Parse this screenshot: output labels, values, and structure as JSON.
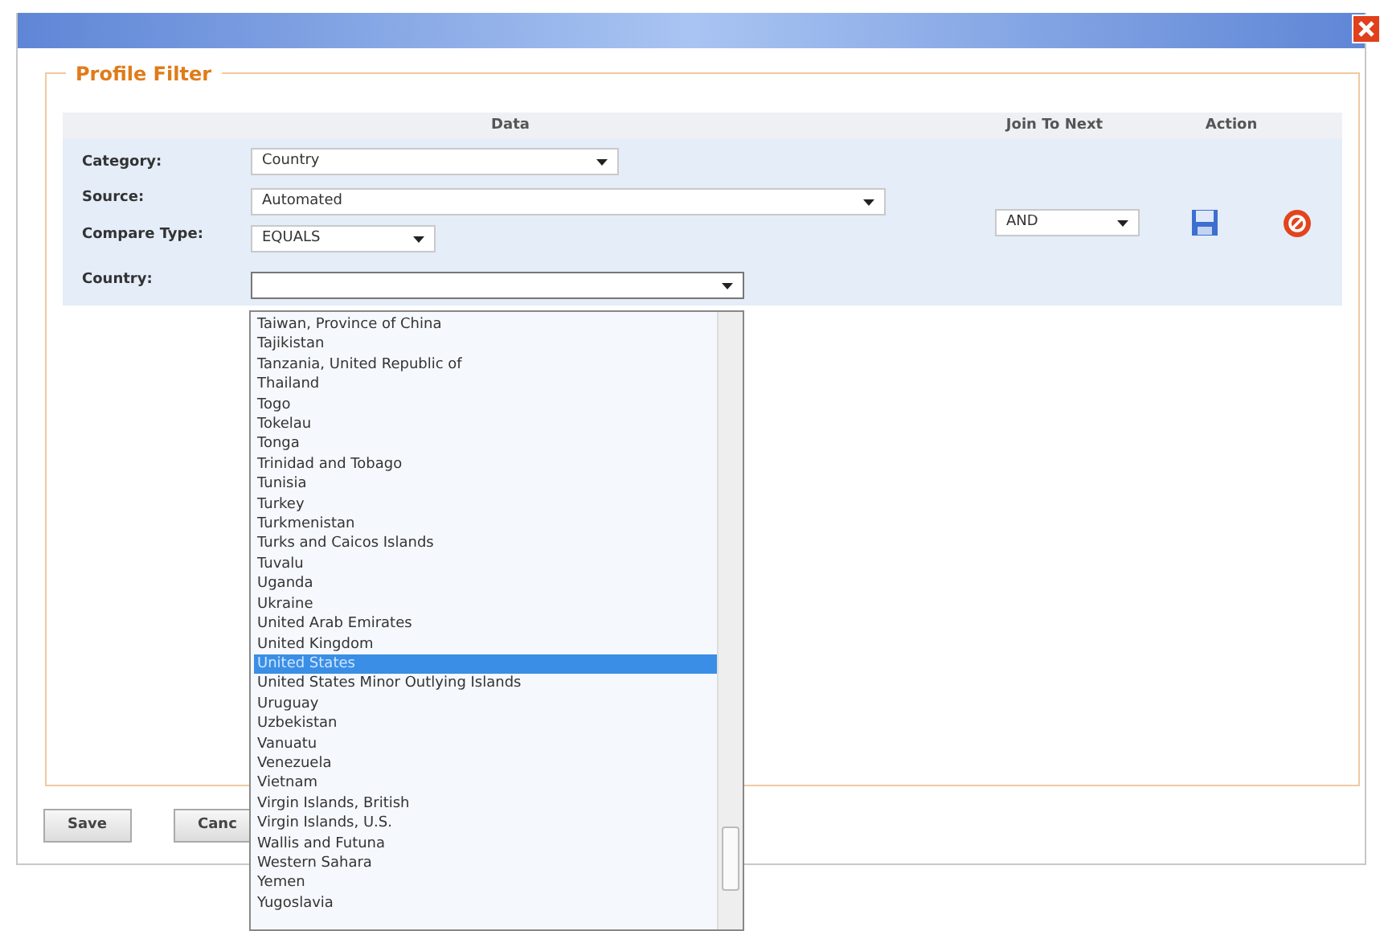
{
  "fieldset": {
    "legend": "Profile Filter"
  },
  "table": {
    "columns": [
      "Data",
      "Join To Next",
      "Action"
    ]
  },
  "fields": [
    {
      "label": "Category:",
      "value": "Country",
      "kind": "short"
    },
    {
      "label": "Source:",
      "value": "Automated",
      "kind": "long"
    },
    {
      "label": "Compare Type:",
      "value": "EQUALS",
      "kind": "tiny"
    },
    {
      "label": "Country:",
      "kind": "medium",
      "expanded": true
    }
  ],
  "join": {
    "value": "AND"
  },
  "dropdown": {
    "items": [
      {
        "label": "Taiwan, Province of China",
        "selected": false
      },
      {
        "label": "Tajikistan",
        "selected": false
      },
      {
        "label": "Tanzania, United Republic of",
        "selected": false
      },
      {
        "label": "Thailand",
        "selected": false
      },
      {
        "label": "Togo",
        "selected": false
      },
      {
        "label": "Tokelau",
        "selected": false
      },
      {
        "label": "Tonga",
        "selected": false
      },
      {
        "label": "Trinidad and Tobago",
        "selected": false
      },
      {
        "label": "Tunisia",
        "selected": false
      },
      {
        "label": "Turkey",
        "selected": false
      },
      {
        "label": "Turkmenistan",
        "selected": false
      },
      {
        "label": "Turks and Caicos Islands",
        "selected": false
      },
      {
        "label": "Tuvalu",
        "selected": false
      },
      {
        "label": "Uganda",
        "selected": false
      },
      {
        "label": "Ukraine",
        "selected": false
      },
      {
        "label": "United Arab Emirates",
        "selected": false
      },
      {
        "label": "United Kingdom",
        "selected": false
      },
      {
        "label": "United States",
        "selected": true
      },
      {
        "label": "United States Minor Outlying Islands",
        "selected": false
      },
      {
        "label": "Uruguay",
        "selected": false
      },
      {
        "label": "Uzbekistan",
        "selected": false
      },
      {
        "label": "Vanuatu",
        "selected": false
      },
      {
        "label": "Venezuela",
        "selected": false
      },
      {
        "label": "Vietnam",
        "selected": false
      },
      {
        "label": "Virgin Islands, British",
        "selected": false
      },
      {
        "label": "Virgin Islands, U.S.",
        "selected": false
      },
      {
        "label": "Wallis and Futuna",
        "selected": false
      },
      {
        "label": "Western Sahara",
        "selected": false
      },
      {
        "label": "Yemen",
        "selected": false
      },
      {
        "label": "Yugoslavia",
        "selected": false
      }
    ]
  },
  "buttons": [
    "Save",
    "Canc"
  ]
}
